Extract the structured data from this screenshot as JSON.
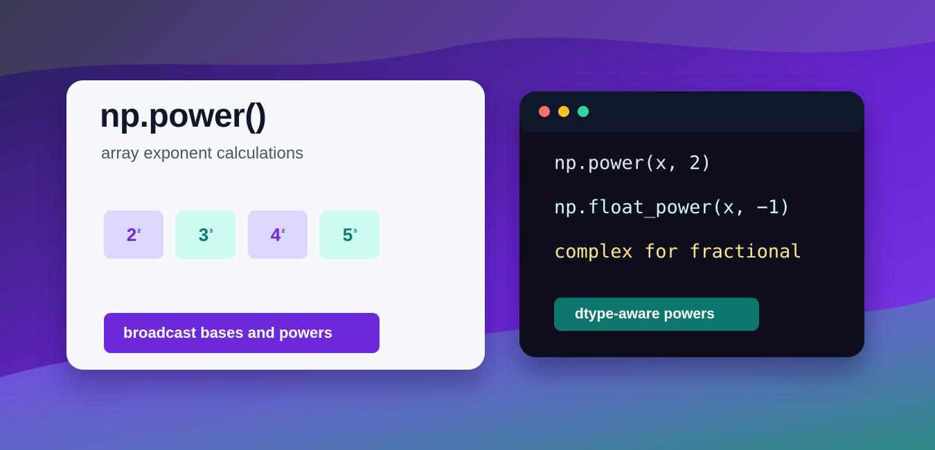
{
  "colors": {
    "accent_purple": "#6d28d9",
    "accent_teal": "#0f766e",
    "chip_purple_bg": "#ddd6fe",
    "chip_mint_bg": "#ccfbf1",
    "terminal_bg": "#0e0e1c",
    "dot_red": "#f87171",
    "dot_yellow": "#fbbf24",
    "dot_green": "#34d399"
  },
  "info_card": {
    "title": "np.power()",
    "subtitle": "array exponent calculations",
    "chips": [
      {
        "base": "2",
        "exponent": "²",
        "style": "purple"
      },
      {
        "base": "3",
        "exponent": "³",
        "style": "mint"
      },
      {
        "base": "4",
        "exponent": "²",
        "style": "purple"
      },
      {
        "base": "5",
        "exponent": "³",
        "style": "mint"
      }
    ],
    "button_label": "broadcast bases and powers"
  },
  "code_window": {
    "window_dots": [
      "red",
      "yellow",
      "green"
    ],
    "lines": [
      {
        "text": "np.power(x, 2)",
        "color": "#e2e8f0"
      },
      {
        "text": "np.float_power(x, −1)",
        "color": "#ccfbf1"
      },
      {
        "text": "complex for fractional",
        "color": "#fde68a"
      }
    ],
    "button_label": "dtype-aware powers"
  }
}
